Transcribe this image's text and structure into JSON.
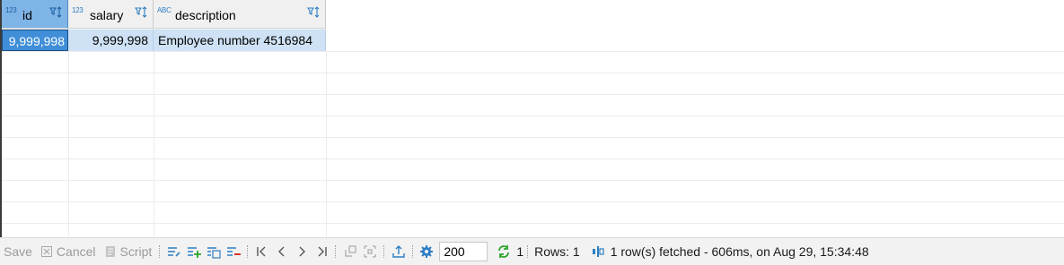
{
  "grid": {
    "columns": [
      {
        "type_badge": "123",
        "name": "id"
      },
      {
        "type_badge": "123",
        "name": "salary"
      },
      {
        "type_badge": "ABC",
        "name": "description"
      }
    ],
    "rows": [
      {
        "id": "9,999,998",
        "salary": "9,999,998",
        "description": "Employee number 4516984"
      }
    ]
  },
  "toolbar": {
    "save_label": "Save",
    "cancel_label": "Cancel",
    "script_label": "Script",
    "fetch_size": "200",
    "refresh_count": "1",
    "rows_label": "Rows: 1",
    "status_text": "1 row(s) fetched - 606ms, on Aug 29, 15:34:48"
  },
  "colors": {
    "selected_cell": "#3f8ed7",
    "selected_row": "#cfe2f5",
    "selected_header": "#7fb4e6",
    "accent": "#2d7ec4",
    "refresh_green": "#2aa52a"
  }
}
